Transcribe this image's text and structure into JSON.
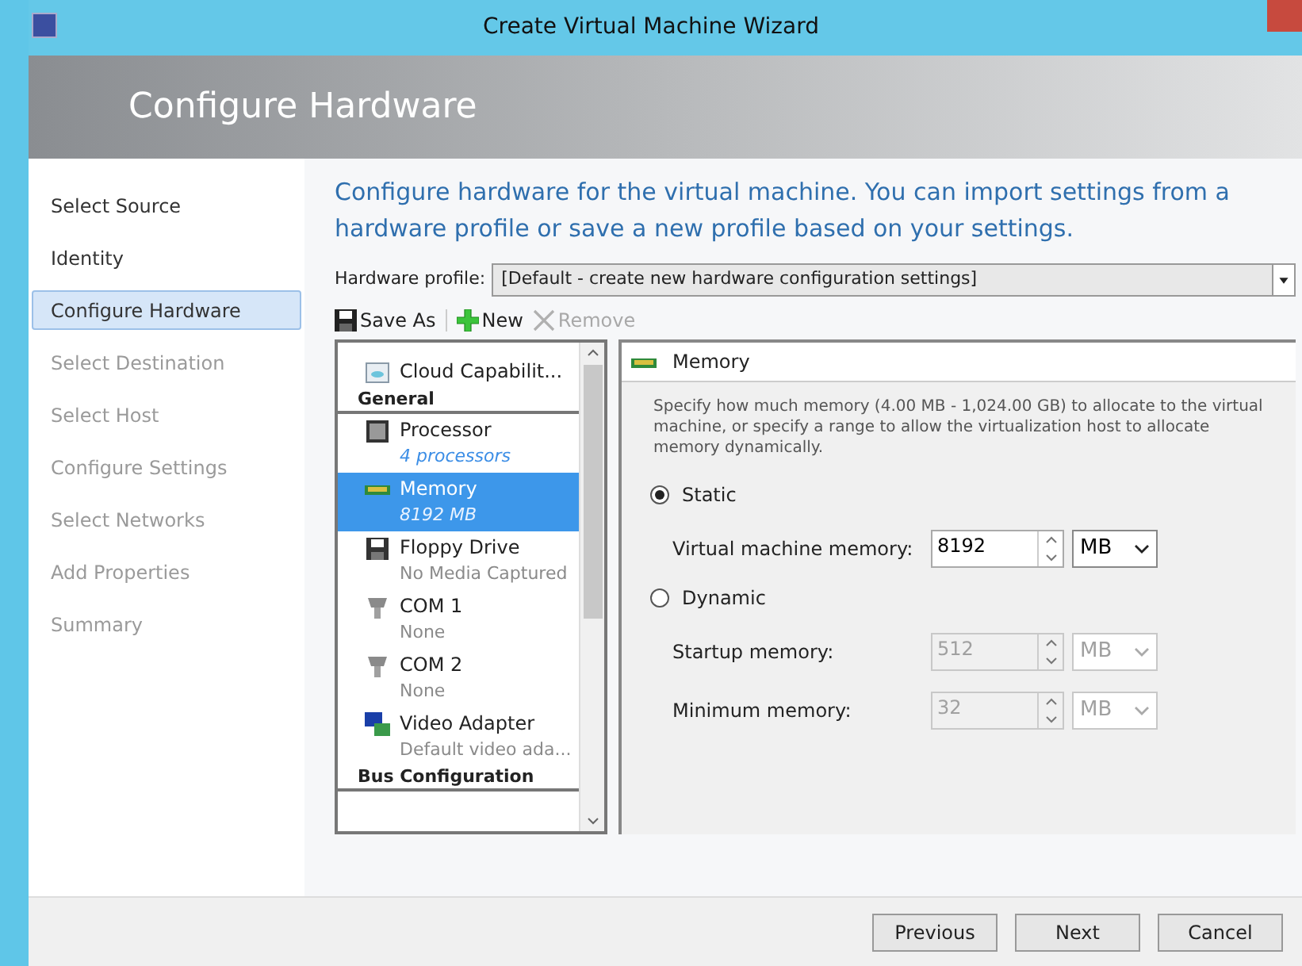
{
  "window": {
    "title": "Create Virtual Machine Wizard"
  },
  "header": {
    "title": "Configure Hardware"
  },
  "sidebar": {
    "items": [
      {
        "label": "Select Source",
        "selected": false,
        "disabled": false
      },
      {
        "label": "Identity",
        "selected": false,
        "disabled": false
      },
      {
        "label": "Configure Hardware",
        "selected": true,
        "disabled": false
      },
      {
        "label": "Select Destination",
        "selected": false,
        "disabled": true
      },
      {
        "label": "Select Host",
        "selected": false,
        "disabled": true
      },
      {
        "label": "Configure Settings",
        "selected": false,
        "disabled": true
      },
      {
        "label": "Select Networks",
        "selected": false,
        "disabled": true
      },
      {
        "label": "Add Properties",
        "selected": false,
        "disabled": true
      },
      {
        "label": "Summary",
        "selected": false,
        "disabled": true
      }
    ]
  },
  "intro": "Configure hardware for the virtual machine. You can import settings from a hardware profile or save a new profile based on your settings.",
  "hardware_profile": {
    "label": "Hardware profile:",
    "value": "[Default - create new hardware configuration settings]"
  },
  "toolbar": [
    {
      "kind": "save",
      "label": "Save As",
      "disabled": false
    },
    {
      "kind": "new",
      "label": "New",
      "disabled": false
    },
    {
      "kind": "remove",
      "label": "Remove",
      "disabled": true
    }
  ],
  "hardware_list": [
    {
      "kind": "cloud",
      "name": "Cloud Capabilit...",
      "selected": false
    },
    {
      "kind": "group",
      "name": "General"
    },
    {
      "kind": "cpu",
      "name": "Processor",
      "detail": "4 processors",
      "selected": false
    },
    {
      "kind": "memory",
      "name": "Memory",
      "detail": "8192 MB",
      "selected": true
    },
    {
      "kind": "floppy",
      "name": "Floppy Drive",
      "detail": "No Media Captured",
      "selected": false
    },
    {
      "kind": "port",
      "name": "COM 1",
      "detail": "None",
      "selected": false
    },
    {
      "kind": "port",
      "name": "COM 2",
      "detail": "None",
      "selected": false
    },
    {
      "kind": "video",
      "name": "Video Adapter",
      "detail": "Default video ada...",
      "selected": false
    },
    {
      "kind": "group",
      "name": "Bus Configuration"
    }
  ],
  "memory_panel": {
    "title": "Memory",
    "description": "Specify how much memory (4.00 MB - 1,024.00 GB) to allocate to the virtual machine, or specify a range to allow the virtualization host to allocate memory dynamically.",
    "options": [
      {
        "label": "Static",
        "selected": true,
        "fields": [
          {
            "label": "Virtual machine memory:",
            "value": "8192",
            "unit": "MB",
            "disabled": false
          }
        ]
      },
      {
        "label": "Dynamic",
        "selected": false,
        "fields": [
          {
            "label": "Startup memory:",
            "value": "512",
            "unit": "MB",
            "disabled": true
          },
          {
            "label": "Minimum memory:",
            "value": "32",
            "unit": "MB",
            "disabled": true
          }
        ]
      }
    ]
  },
  "buttons": [
    "Previous",
    "Next",
    "Cancel"
  ]
}
